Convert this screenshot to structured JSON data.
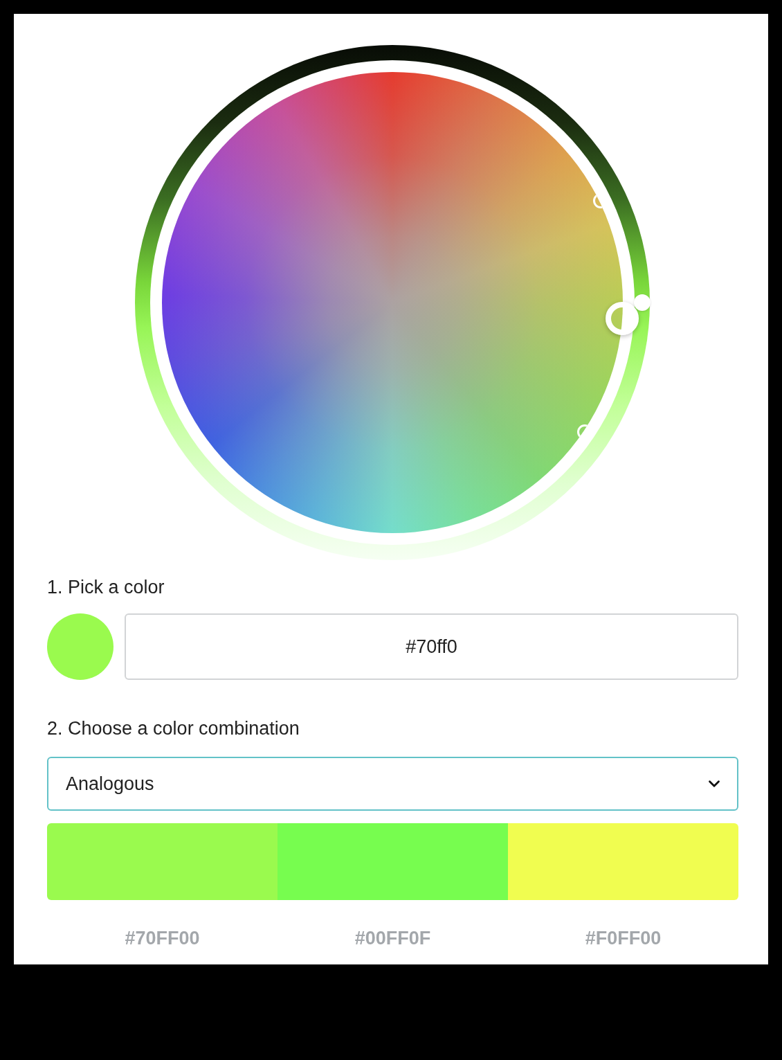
{
  "pick_color": {
    "label": "1. Pick a color",
    "swatch": {
      "color": "#9afa4e"
    },
    "hex_input": {
      "value": "#70ff0"
    }
  },
  "combination": {
    "label": "2. Choose a color combination",
    "dropdown": {
      "value": "Analogous"
    }
  },
  "palette": [
    {
      "color": "#9afa4e",
      "hex": "#70FF00"
    },
    {
      "color": "#77fd4f",
      "hex": "#00FF0F"
    },
    {
      "color": "#f0fd50",
      "hex": "#F0FF00"
    }
  ]
}
